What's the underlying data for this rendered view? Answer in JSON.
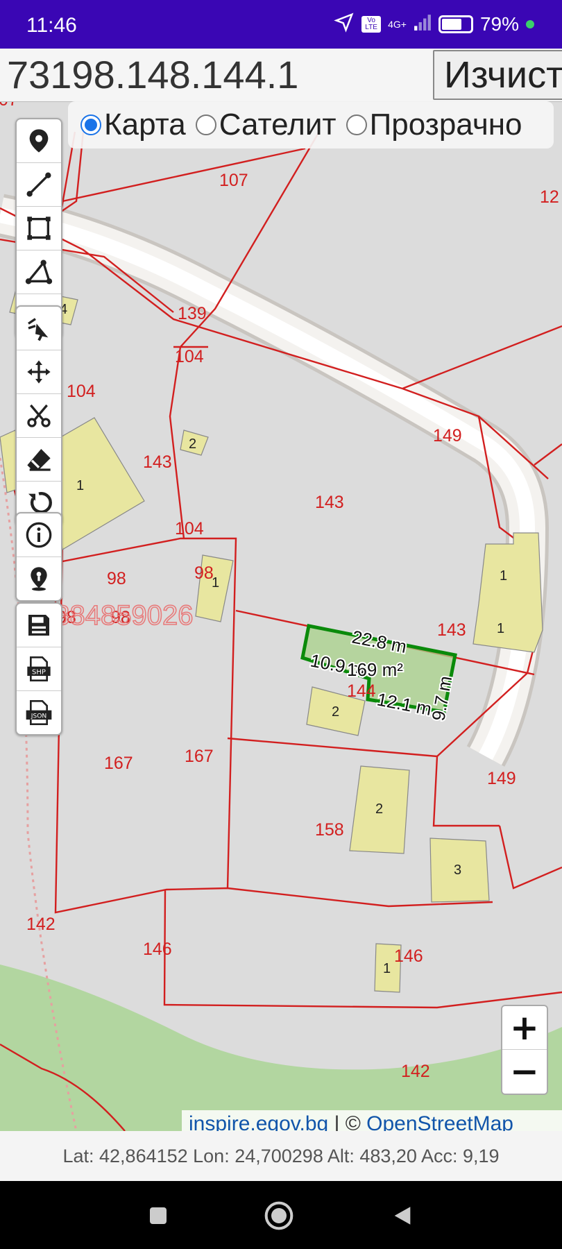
{
  "status_bar": {
    "time": "11:46",
    "battery": "79%",
    "battery_level": 0.79,
    "network": "4G+",
    "volte": "Vo LTE"
  },
  "search": {
    "value": "73198.148.144.1",
    "clear_label": "Изчист"
  },
  "layers": {
    "options": [
      "Карта",
      "Сателит",
      "Прозрачно"
    ],
    "selected": "Карта"
  },
  "toolbar": {
    "group1": [
      "location-pin-icon",
      "line-measure-icon",
      "rectangle-icon",
      "polygon-icon",
      "circle-icon"
    ],
    "group2": [
      "select-pointer-icon",
      "move-icon",
      "scissors-icon",
      "eraser-icon",
      "undo-icon"
    ],
    "group3": [
      "info-icon",
      "my-location-icon"
    ],
    "group4": [
      "save-icon",
      "export-shp-icon",
      "export-json-icon"
    ]
  },
  "map": {
    "parcel_labels": [
      "07",
      "107",
      "12",
      "4",
      "139",
      "104",
      "104",
      "2",
      "143",
      "149",
      "143",
      "1",
      "104",
      "98",
      "98",
      "1",
      "98",
      "98",
      "143",
      "1",
      "1",
      "144",
      "2",
      "167",
      "167",
      "149",
      "158",
      "2",
      "3",
      "142",
      "146",
      "146",
      "1",
      "142"
    ],
    "watermark": "0884859026",
    "measurement": {
      "side_a": "22.8 m",
      "side_b": "10.9 m",
      "area": "169 m²",
      "side_c": "12.1 m",
      "side_d": "9.7 m"
    }
  },
  "zoom": {
    "in": "+",
    "out": "−"
  },
  "attribution": {
    "text1": "inspire.egov.bg",
    "sep": " | © ",
    "text2": "OpenStreetMap"
  },
  "footer": {
    "coords": "Lat: 42,864152 Lon: 24,700298 Alt: 483,20 Acc: 9,19"
  },
  "colors": {
    "status": "#3a06b4",
    "parcel": "#d21f1f",
    "building": "#e8e6a0",
    "highlight": "#0a8a0a",
    "forest": "#b2d6a0"
  }
}
